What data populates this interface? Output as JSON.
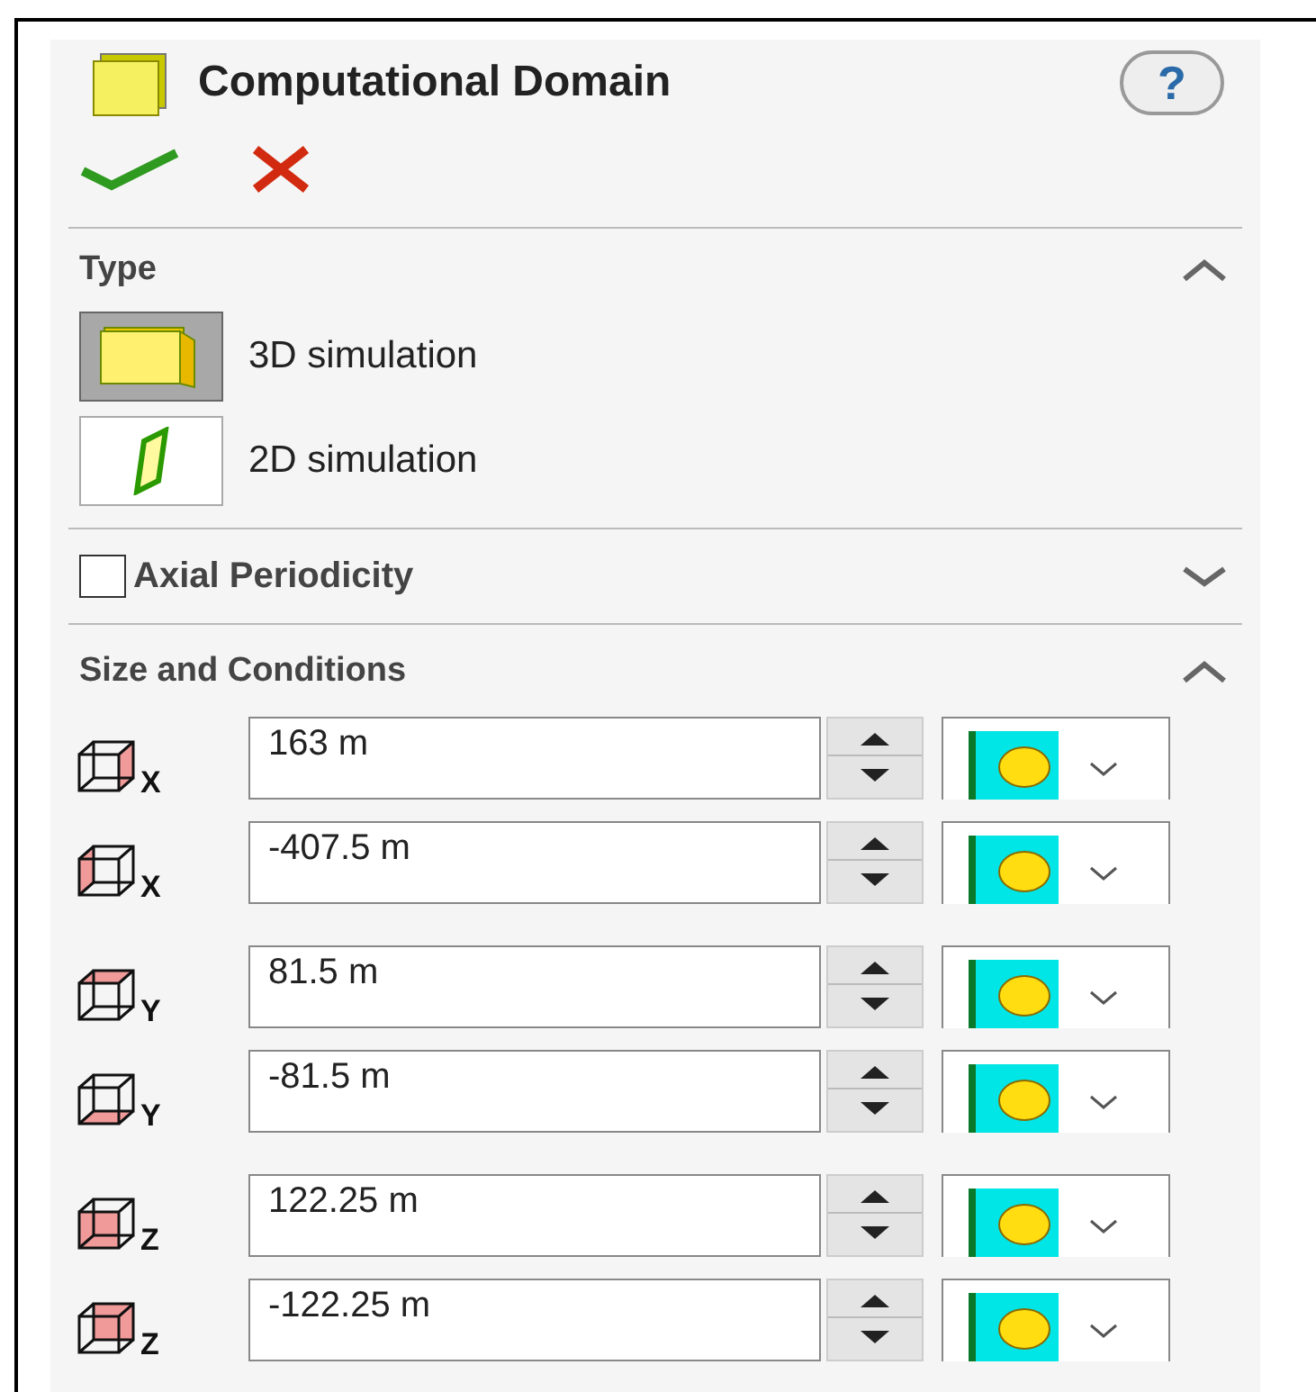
{
  "title": "Computational Domain",
  "help_label": "?",
  "type_section": {
    "title": "Type",
    "expanded": true,
    "options": [
      {
        "kind": "cube",
        "label": "3D simulation",
        "selected": true
      },
      {
        "kind": "plane",
        "label": "2D simulation",
        "selected": false
      }
    ]
  },
  "axial_section": {
    "title": "Axial Periodicity",
    "checked": false,
    "expanded": false
  },
  "size_section": {
    "title": "Size and Conditions",
    "expanded": true,
    "rows": [
      {
        "kind": "x-max",
        "axis": "X",
        "value": "163 m"
      },
      {
        "kind": "x-min",
        "axis": "X",
        "value": "-407.5 m"
      },
      {
        "kind": "y-max",
        "axis": "Y",
        "value": "81.5 m"
      },
      {
        "kind": "y-min",
        "axis": "Y",
        "value": "-81.5 m"
      },
      {
        "kind": "z-max",
        "axis": "Z",
        "value": "122.25 m"
      },
      {
        "kind": "z-min",
        "axis": "Z",
        "value": "-122.25 m"
      }
    ]
  }
}
